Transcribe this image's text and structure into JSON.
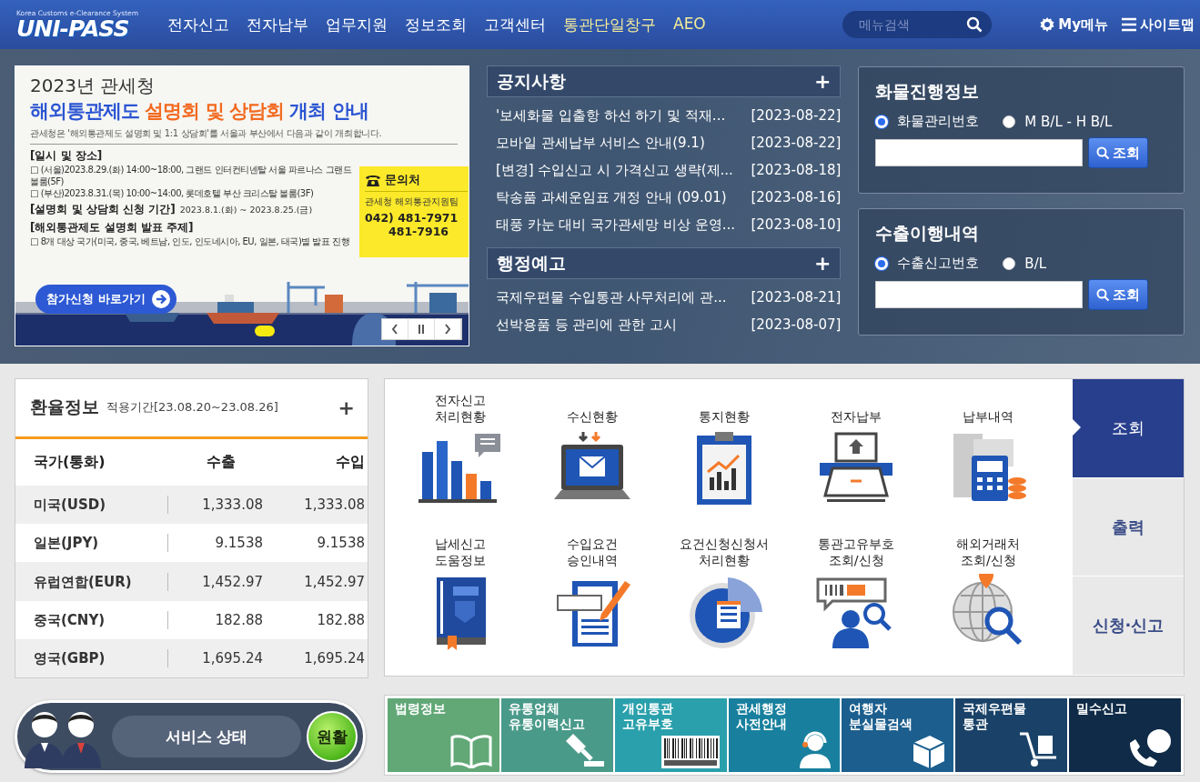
{
  "header": {
    "logo": {
      "tagline": "Korea Customs e-Clearance System",
      "name": "UNI-PASS"
    },
    "nav": [
      {
        "label": "전자신고",
        "highlight": false
      },
      {
        "label": "전자납부",
        "highlight": false
      },
      {
        "label": "업무지원",
        "highlight": false
      },
      {
        "label": "정보조회",
        "highlight": false
      },
      {
        "label": "고객센터",
        "highlight": false
      },
      {
        "label": "통관단일창구",
        "highlight": true
      },
      {
        "label": "AEO",
        "highlight": true
      }
    ],
    "search": {
      "placeholder": "메뉴검색"
    },
    "links": [
      {
        "kind": "gear",
        "label": "My메뉴"
      },
      {
        "kind": "menu",
        "label": "사이트맵"
      }
    ]
  },
  "banner": {
    "title": "2023년 관세청",
    "headline": [
      {
        "text": "해외통관제도 ",
        "accent": false
      },
      {
        "text": "설명회 및 상담회",
        "accent": true
      },
      {
        "text": " 개최 안내",
        "accent": false
      }
    ],
    "intro": "관세청은 '해외통관제도 설명회 및 1:1 상담회'를 서울과 부산에서 다음과 같이 개최합니다.",
    "sections": [
      {
        "heading": "[일시 및 장소]",
        "lines": [
          "□ (서울)2023.8.29.(화) 14:00~18:00, 그랜드 인터컨티넨탈 서울 파르나스 그랜드 볼룸(5F)",
          "□ (부산)2023.8.31.(목) 10:00~14:00, 롯데호텔 부산 크리스탈 볼룸(3F)"
        ]
      },
      {
        "heading": "[설명회 및 상담회 신청 기간]",
        "note": "2023.8.1.(화) ~ 2023.8.25.(금)"
      },
      {
        "heading": "[해외통관제도 설명회 발표 주제]",
        "lines": [
          "□ 8개 대상 국가(미국, 중국, 베트남, 인도, 인도네시아, EU, 일본, 태국)별 발표 진행"
        ]
      }
    ],
    "contact": {
      "title": "문의처",
      "team": "관세청 해외통관지원팀",
      "phones": [
        "042) 481-7971",
        "481-7916"
      ]
    },
    "cta": "참가신청 바로가기"
  },
  "notices": {
    "title": "공지사항",
    "more": "+",
    "items": [
      {
        "title": "'보세화물 입출항 하선 하기 및 적재...",
        "date": "[2023-08-22]"
      },
      {
        "title": "모바일 관세납부 서비스 안내(9.1)",
        "date": "[2023-08-22]"
      },
      {
        "title": "[변경] 수입신고 시 가격신고 생략(제...",
        "date": "[2023-08-18]"
      },
      {
        "title": "탁송품 과세운임표 개정 안내 (09.01)",
        "date": "[2023-08-16]"
      },
      {
        "title": "태풍 카눈 대비 국가관세망 비상 운영...",
        "date": "[2023-08-10]"
      }
    ]
  },
  "admin_notices": {
    "title": "행정예고",
    "more": "+",
    "items": [
      {
        "title": "국제우편물 수입통관 사무처리에 관...",
        "date": "[2023-08-21]"
      },
      {
        "title": "선박용품 등 관리에 관한 고시",
        "date": "[2023-08-07]"
      }
    ]
  },
  "lookups": [
    {
      "title": "화물진행정보",
      "options": [
        {
          "label": "화물관리번호",
          "selected": true
        },
        {
          "label": "M B/L - H B/L",
          "selected": false
        }
      ],
      "button": "조회"
    },
    {
      "title": "수출이행내역",
      "options": [
        {
          "label": "수출신고번호",
          "selected": true
        },
        {
          "label": "B/L",
          "selected": false
        }
      ],
      "button": "조회"
    }
  ],
  "exchange": {
    "title": "환율정보",
    "period": "적용기간[23.08.20~23.08.26]",
    "more": "+",
    "columns": [
      "국가(통화)",
      "수출",
      "수입"
    ],
    "rows": [
      {
        "country": "미국(USD)",
        "export": "1,333.08",
        "import": "1,333.08"
      },
      {
        "country": "일본(JPY)",
        "export": "9.1538",
        "import": "9.1538"
      },
      {
        "country": "유럽연합(EUR)",
        "export": "1,452.97",
        "import": "1,452.97"
      },
      {
        "country": "중국(CNY)",
        "export": "182.88",
        "import": "182.88"
      },
      {
        "country": "영국(GBP)",
        "export": "1,695.24",
        "import": "1,695.24"
      }
    ]
  },
  "services": {
    "items": [
      {
        "label": "전자신고\n처리현황"
      },
      {
        "label": "수신현황"
      },
      {
        "label": "통지현황"
      },
      {
        "label": "전자납부"
      },
      {
        "label": "납부내역"
      },
      {
        "label": "납세신고\n도움정보"
      },
      {
        "label": "수입요건\n승인내역"
      },
      {
        "label": "요건신청신청서\n처리현황"
      },
      {
        "label": "통관고유부호\n조회/신청"
      },
      {
        "label": "해외거래처\n조회/신청"
      }
    ],
    "tabs": [
      {
        "label": "조회",
        "selected": true
      },
      {
        "label": "출력",
        "selected": false
      },
      {
        "label": "신청·신고",
        "selected": false
      }
    ]
  },
  "status": {
    "label": "서비스 상태",
    "value": "원활"
  },
  "quick_links": [
    {
      "label": "법령정보",
      "color": "#62a877"
    },
    {
      "label": "유통업체\n유통이력신고",
      "color": "#4a9a8a"
    },
    {
      "label": "개인통관\n고유부호",
      "color": "#2aa0ac"
    },
    {
      "label": "관세행정\n사전안내",
      "color": "#18809e"
    },
    {
      "label": "여행자\n분실물검색",
      "color": "#1c5f8e"
    },
    {
      "label": "국제우편물\n통관",
      "color": "#1a4268"
    },
    {
      "label": "밀수신고",
      "color": "#0f2b47"
    }
  ]
}
